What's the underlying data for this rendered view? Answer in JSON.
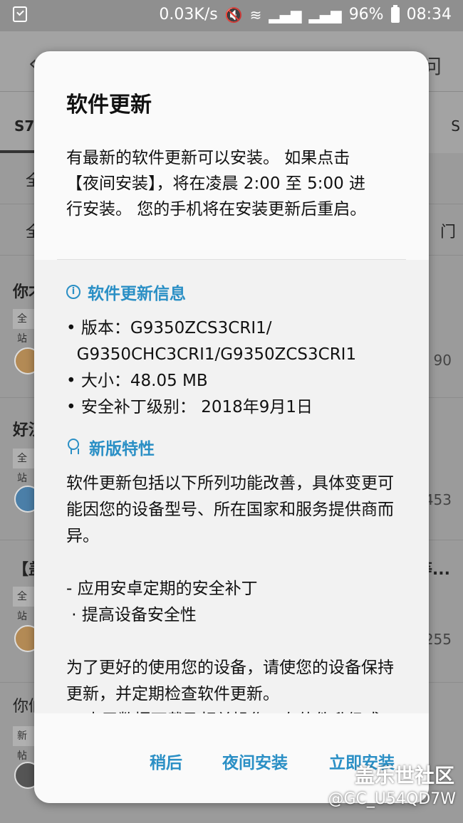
{
  "status_bar": {
    "net_speed": "0.03K/s",
    "battery": "96%",
    "time": "08:34"
  },
  "background": {
    "header_right": "问",
    "tab_active": "S7",
    "tab_right": "S",
    "rows": [
      {
        "t1": "全"
      },
      {
        "t1": "全",
        "right": "门"
      },
      {
        "title": "你才",
        "chip": "全站",
        "num": "90"
      },
      {
        "title": "好汉",
        "chip": "全站",
        "num": "453"
      },
      {
        "title": "【盖",
        "chip": "全站",
        "right": "等...",
        "num": "255"
      },
      {
        "title": "你们",
        "chip": "新帖"
      }
    ]
  },
  "dialog": {
    "title": "软件更新",
    "intro": "有最新的软件更新可以安装。 如果点击【夜间安装】，将在凌晨 2:00 至 5:00 进行安装。 您的手机将在安装更新后重启。",
    "info_section": {
      "heading": "软件更新信息",
      "version_line1": "• 版本：G9350ZCS3CRI1/",
      "version_line2": "  G9350CHC3CRI1/G9350ZCS3CRI1",
      "size": "• 大小：48.05 MB",
      "patch": "• 安全补丁级别： 2018年9月1日"
    },
    "features_section": {
      "heading": "新版特性",
      "para1": "软件更新包括以下所列功能改善，具体变更可能因您的设备型号、所在国家和服务提供商而异。",
      "item1": "- 应用安卓定期的安全补丁",
      "item2": " · 提高设备安全性",
      "para2": "为了更好的使用您的设备，请使您的设备保持更新，并定期检查软件更新。",
      "para3": "※ 由于数据下载及相关操作，在软件升级或更新期间，设备的温度可能"
    },
    "actions": {
      "later": "稍后",
      "night_install": "夜间安装",
      "install_now": "立即安装"
    }
  },
  "watermark": {
    "line1": "盖乐世社区",
    "line2": "@GC_U54QD7W"
  }
}
